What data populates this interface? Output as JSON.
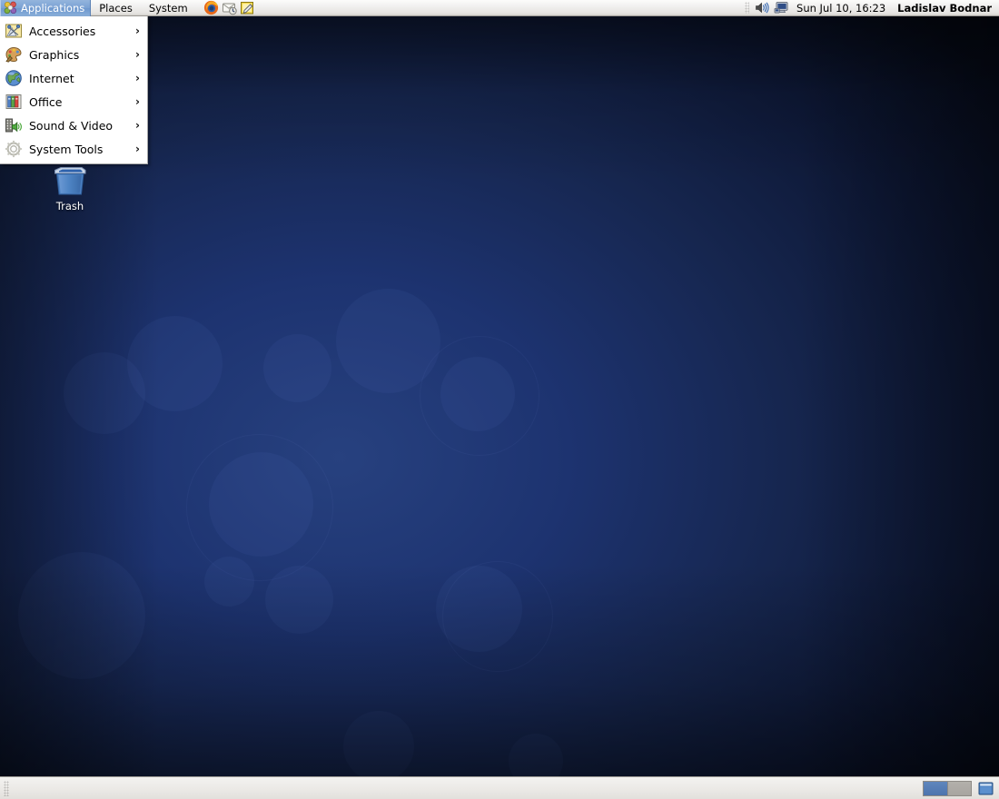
{
  "panel_top": {
    "menus": [
      {
        "label": "Applications",
        "icon": "applications-menu-icon",
        "selected": true
      },
      {
        "label": "Places",
        "icon": null,
        "selected": false
      },
      {
        "label": "System",
        "icon": null,
        "selected": false
      }
    ],
    "launchers": [
      {
        "name": "firefox-launcher-icon",
        "title": "Firefox Web Browser"
      },
      {
        "name": "evolution-mail-launcher-icon",
        "title": "Evolution Mail"
      },
      {
        "name": "text-editor-launcher-icon",
        "title": "Text Editor"
      }
    ],
    "tray": [
      {
        "name": "volume-icon"
      },
      {
        "name": "network-monitor-icon"
      }
    ],
    "clock": "Sun Jul 10, 16:23",
    "username": "Ladislav Bodnar"
  },
  "app_menu": {
    "items": [
      {
        "label": "Accessories",
        "icon": "accessories-icon",
        "has_submenu": true,
        "arrow": "›"
      },
      {
        "label": "Graphics",
        "icon": "graphics-icon",
        "has_submenu": true,
        "arrow": "›"
      },
      {
        "label": "Internet",
        "icon": "internet-icon",
        "has_submenu": true,
        "arrow": "›"
      },
      {
        "label": "Office",
        "icon": "office-icon",
        "has_submenu": true,
        "arrow": "›"
      },
      {
        "label": "Sound & Video",
        "icon": "sound-video-icon",
        "has_submenu": true,
        "arrow": "›"
      },
      {
        "label": "System Tools",
        "icon": "system-tools-icon",
        "has_submenu": true,
        "arrow": "›"
      }
    ]
  },
  "desktop": {
    "icons": [
      {
        "label": "Trash",
        "name": "trash-desktop-icon"
      }
    ],
    "background_colors": {
      "center": "#27417f",
      "mid": "#1d3370",
      "edge": "#0a1128"
    }
  },
  "panel_bottom": {
    "workspaces": [
      {
        "label": "Workspace 1",
        "active": true
      },
      {
        "label": "Workspace 2",
        "active": false
      }
    ],
    "trash_applet": "trash-applet-icon",
    "window_list": []
  }
}
